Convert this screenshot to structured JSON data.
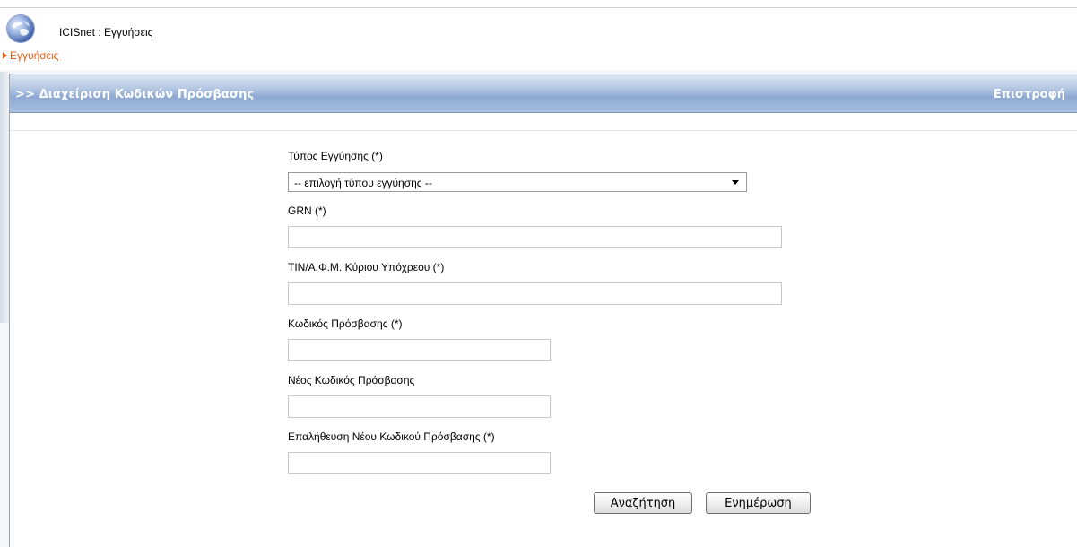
{
  "app": {
    "title": "ICISnet : Εγγυήσεις",
    "icon": "globe-icon"
  },
  "breadcrumb": {
    "label": "Εγγυήσεις",
    "color": "#e85a12"
  },
  "panel": {
    "title": ">> Διαχείριση Κωδικών Πρόσβασης",
    "back_label": "Επιστροφή"
  },
  "form": {
    "guarantee_type": {
      "label": "Τύπος Εγγύησης (*)",
      "selected": "-- επιλογή τύπου εγγύησης --"
    },
    "grn": {
      "label": "GRN (*)",
      "value": ""
    },
    "tin": {
      "label": "TIN/Α.Φ.Μ. Κύριου Υπόχρεου (*)",
      "value": ""
    },
    "access_code": {
      "label": "Κωδικός Πρόσβασης (*)",
      "value": ""
    },
    "new_access_code": {
      "label": "Νέος Κωδικός Πρόσβασης",
      "value": ""
    },
    "confirm_new_access_code": {
      "label": "Επαλήθευση Νέου Κωδικού Πρόσβασης (*)",
      "value": ""
    }
  },
  "buttons": {
    "search_label": "Αναζήτηση",
    "update_label": "Ενημέρωση"
  },
  "colors": {
    "header_gradient_mid": "#8ea9d3",
    "accent_orange": "#e85a12"
  }
}
